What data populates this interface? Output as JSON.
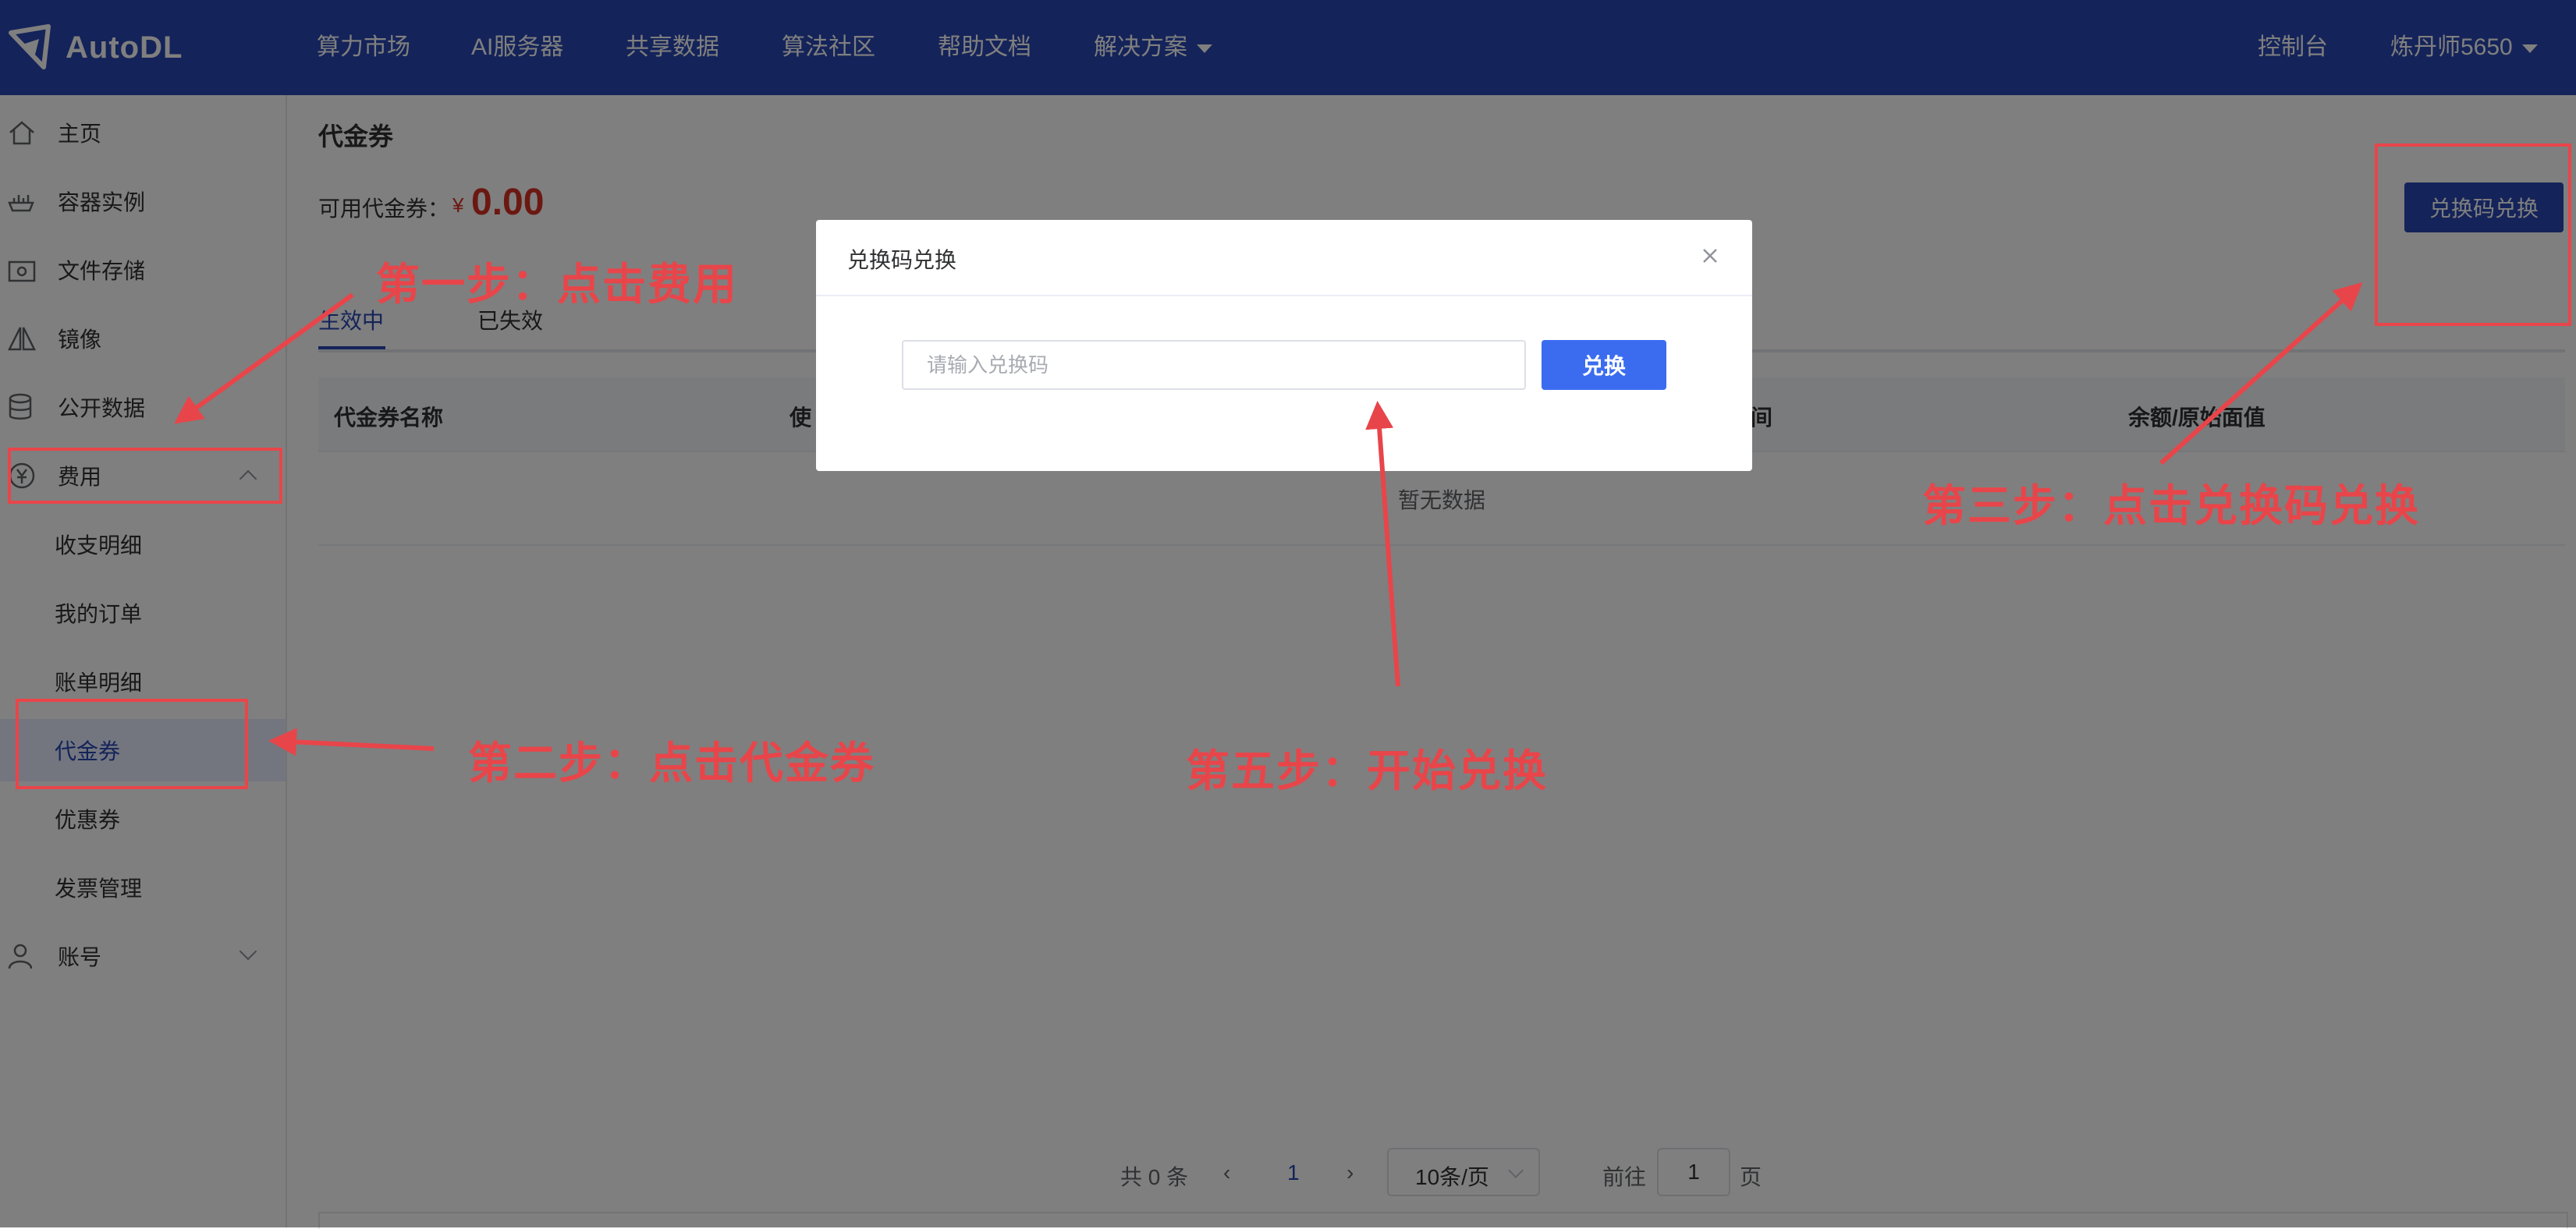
{
  "app": {
    "brand": "AutoDL"
  },
  "topnav": {
    "items": [
      "算力市场",
      "AI服务器",
      "共享数据",
      "算法社区",
      "帮助文档",
      "解决方案"
    ],
    "console": "控制台",
    "user": "炼丹师5650"
  },
  "sidebar": {
    "items": [
      {
        "label": "主页",
        "icon": "home-icon"
      },
      {
        "label": "容器实例",
        "icon": "container-icon"
      },
      {
        "label": "文件存储",
        "icon": "folder-icon"
      },
      {
        "label": "镜像",
        "icon": "mirror-icon"
      },
      {
        "label": "公开数据",
        "icon": "database-icon"
      },
      {
        "label": "费用",
        "icon": "yuan-icon"
      }
    ],
    "billing_sub": [
      "收支明细",
      "我的订单",
      "账单明细",
      "代金券",
      "优惠券",
      "发票管理"
    ],
    "account": "账号"
  },
  "main": {
    "title": "代金券",
    "balance_label": "可用代金券：",
    "balance_currency": "¥",
    "balance_value": "0.00",
    "redeem_button": "兑换码兑换",
    "tabs": [
      "生效中",
      "已失效"
    ],
    "columns": [
      "代金券名称",
      "使",
      "间",
      "余额/原始面值"
    ],
    "empty": "暂无数据"
  },
  "pagination": {
    "total": "共 0 条",
    "current_page": "1",
    "page_size": "10条/页",
    "goto": "前往",
    "goto_value": "1",
    "page_unit": "页"
  },
  "dialog": {
    "title": "兑换码兑换",
    "placeholder": "请输入兑换码",
    "submit": "兑换"
  },
  "annotations": {
    "step1": "第一步：点击费用",
    "step2": "第二步：点击代金券",
    "step3": "第三步：点击兑换码兑换",
    "step5": "第五步：开始兑换"
  },
  "colors": {
    "nav_bg": "#2947b2",
    "primary": "#3b6cf0",
    "price_red": "#d93025",
    "annotation_red": "#e8454a"
  }
}
